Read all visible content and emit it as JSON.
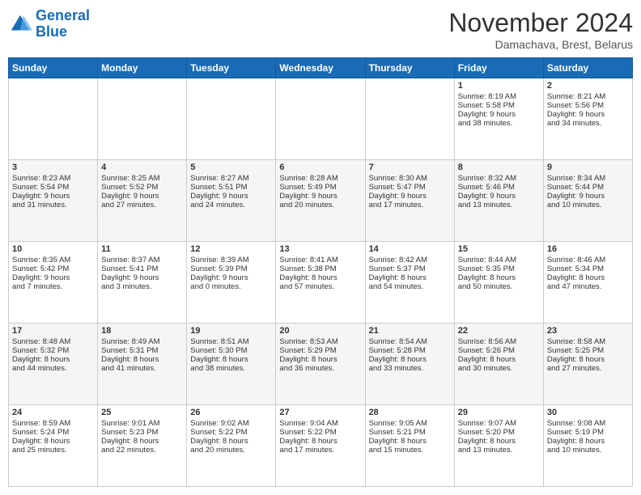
{
  "logo": {
    "line1": "General",
    "line2": "Blue"
  },
  "title": "November 2024",
  "location": "Damachava, Brest, Belarus",
  "days_of_week": [
    "Sunday",
    "Monday",
    "Tuesday",
    "Wednesday",
    "Thursday",
    "Friday",
    "Saturday"
  ],
  "weeks": [
    [
      {
        "day": "",
        "info": ""
      },
      {
        "day": "",
        "info": ""
      },
      {
        "day": "",
        "info": ""
      },
      {
        "day": "",
        "info": ""
      },
      {
        "day": "",
        "info": ""
      },
      {
        "day": "1",
        "info": "Sunrise: 8:19 AM\nSunset: 5:58 PM\nDaylight: 9 hours\nand 38 minutes."
      },
      {
        "day": "2",
        "info": "Sunrise: 8:21 AM\nSunset: 5:56 PM\nDaylight: 9 hours\nand 34 minutes."
      }
    ],
    [
      {
        "day": "3",
        "info": "Sunrise: 8:23 AM\nSunset: 5:54 PM\nDaylight: 9 hours\nand 31 minutes."
      },
      {
        "day": "4",
        "info": "Sunrise: 8:25 AM\nSunset: 5:52 PM\nDaylight: 9 hours\nand 27 minutes."
      },
      {
        "day": "5",
        "info": "Sunrise: 8:27 AM\nSunset: 5:51 PM\nDaylight: 9 hours\nand 24 minutes."
      },
      {
        "day": "6",
        "info": "Sunrise: 8:28 AM\nSunset: 5:49 PM\nDaylight: 9 hours\nand 20 minutes."
      },
      {
        "day": "7",
        "info": "Sunrise: 8:30 AM\nSunset: 5:47 PM\nDaylight: 9 hours\nand 17 minutes."
      },
      {
        "day": "8",
        "info": "Sunrise: 8:32 AM\nSunset: 5:46 PM\nDaylight: 9 hours\nand 13 minutes."
      },
      {
        "day": "9",
        "info": "Sunrise: 8:34 AM\nSunset: 5:44 PM\nDaylight: 9 hours\nand 10 minutes."
      }
    ],
    [
      {
        "day": "10",
        "info": "Sunrise: 8:35 AM\nSunset: 5:42 PM\nDaylight: 9 hours\nand 7 minutes."
      },
      {
        "day": "11",
        "info": "Sunrise: 8:37 AM\nSunset: 5:41 PM\nDaylight: 9 hours\nand 3 minutes."
      },
      {
        "day": "12",
        "info": "Sunrise: 8:39 AM\nSunset: 5:39 PM\nDaylight: 9 hours\nand 0 minutes."
      },
      {
        "day": "13",
        "info": "Sunrise: 8:41 AM\nSunset: 5:38 PM\nDaylight: 8 hours\nand 57 minutes."
      },
      {
        "day": "14",
        "info": "Sunrise: 8:42 AM\nSunset: 5:37 PM\nDaylight: 8 hours\nand 54 minutes."
      },
      {
        "day": "15",
        "info": "Sunrise: 8:44 AM\nSunset: 5:35 PM\nDaylight: 8 hours\nand 50 minutes."
      },
      {
        "day": "16",
        "info": "Sunrise: 8:46 AM\nSunset: 5:34 PM\nDaylight: 8 hours\nand 47 minutes."
      }
    ],
    [
      {
        "day": "17",
        "info": "Sunrise: 8:48 AM\nSunset: 5:32 PM\nDaylight: 8 hours\nand 44 minutes."
      },
      {
        "day": "18",
        "info": "Sunrise: 8:49 AM\nSunset: 5:31 PM\nDaylight: 8 hours\nand 41 minutes."
      },
      {
        "day": "19",
        "info": "Sunrise: 8:51 AM\nSunset: 5:30 PM\nDaylight: 8 hours\nand 38 minutes."
      },
      {
        "day": "20",
        "info": "Sunrise: 8:53 AM\nSunset: 5:29 PM\nDaylight: 8 hours\nand 36 minutes."
      },
      {
        "day": "21",
        "info": "Sunrise: 8:54 AM\nSunset: 5:28 PM\nDaylight: 8 hours\nand 33 minutes."
      },
      {
        "day": "22",
        "info": "Sunrise: 8:56 AM\nSunset: 5:26 PM\nDaylight: 8 hours\nand 30 minutes."
      },
      {
        "day": "23",
        "info": "Sunrise: 8:58 AM\nSunset: 5:25 PM\nDaylight: 8 hours\nand 27 minutes."
      }
    ],
    [
      {
        "day": "24",
        "info": "Sunrise: 8:59 AM\nSunset: 5:24 PM\nDaylight: 8 hours\nand 25 minutes."
      },
      {
        "day": "25",
        "info": "Sunrise: 9:01 AM\nSunset: 5:23 PM\nDaylight: 8 hours\nand 22 minutes."
      },
      {
        "day": "26",
        "info": "Sunrise: 9:02 AM\nSunset: 5:22 PM\nDaylight: 8 hours\nand 20 minutes."
      },
      {
        "day": "27",
        "info": "Sunrise: 9:04 AM\nSunset: 5:22 PM\nDaylight: 8 hours\nand 17 minutes."
      },
      {
        "day": "28",
        "info": "Sunrise: 9:05 AM\nSunset: 5:21 PM\nDaylight: 8 hours\nand 15 minutes."
      },
      {
        "day": "29",
        "info": "Sunrise: 9:07 AM\nSunset: 5:20 PM\nDaylight: 8 hours\nand 13 minutes."
      },
      {
        "day": "30",
        "info": "Sunrise: 9:08 AM\nSunset: 5:19 PM\nDaylight: 8 hours\nand 10 minutes."
      }
    ]
  ]
}
